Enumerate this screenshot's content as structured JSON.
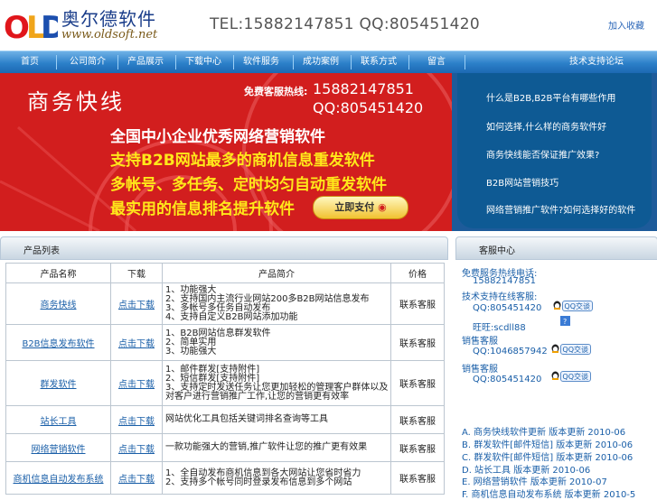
{
  "header": {
    "logo_mark": "OLD",
    "logo_cn": "奥尔德软件",
    "logo_url": "www.oldsoft.net",
    "tel_line": "TEL:15882147851 QQ:805451420",
    "top_link": "加入收藏"
  },
  "nav": {
    "items": [
      "首页",
      "公司简介",
      "产品展示",
      "下载中心",
      "软件服务",
      "成功案例",
      "联系方式",
      "留言",
      "技术支持论坛"
    ]
  },
  "banner": {
    "title": "商务快线",
    "hotline_label": "免费客服热线:",
    "hotline_tel": "15882147851",
    "hotline_qq": "QQ:805451420",
    "slogans": [
      {
        "text": "全国中小企业优秀网络营销软件",
        "color": "#ffffff"
      },
      {
        "text": "支持B2B网站最多的商机信息重发软件",
        "color": "#ffe81a"
      },
      {
        "text": "多帐号、多任务、定时均匀自动重发软件",
        "color": "#ffe81a"
      },
      {
        "text": "最实用的信息排名提升软件",
        "color": "#ffe81a"
      }
    ],
    "pay_button": "立即支付"
  },
  "news": {
    "items": [
      "什么是B2B,B2B平台有哪些作用",
      "如何选择,什么样的商务软件好",
      "商务快线能否保证推广效果?",
      "B2B网站营销技巧",
      "网络营销推广软件?如何选择好的软件"
    ]
  },
  "products": {
    "title": "产品列表",
    "headers": [
      "产品名称",
      "下载",
      "产品简介",
      "价格"
    ],
    "rows": [
      {
        "name": "商务快线",
        "download": "点击下载",
        "desc": [
          "1、功能强大",
          "2、支持国内主流行业网站200多B2B网站信息发布",
          "3、多帐号多任务自动发布",
          "4、支持自定义B2B网站添加功能"
        ],
        "price": "联系客服"
      },
      {
        "name": "B2B信息发布软件",
        "download": "点击下载",
        "desc": [
          "1、B2B网站信息群发软件",
          "2、简单实用",
          "3、功能强大"
        ],
        "price": "联系客服"
      },
      {
        "name": "群发软件",
        "download": "点击下载",
        "desc": [
          "1、邮件群发[支持附件]",
          "2、短信群发[支持附件]",
          "3、支持定时发送任务让您更加轻松的管理客户群体以及对客户进行营销推广工作,让您的营销更有效率"
        ],
        "price": "联系客服"
      },
      {
        "name": "站长工具",
        "download": "点击下载",
        "desc": [
          "网站优化工具包括关键词排名查询等工具"
        ],
        "price": "联系客服"
      },
      {
        "name": "网络营销软件",
        "download": "点击下载",
        "desc": [
          "一款功能强大的营销,推广软件让您的推广更有效果"
        ],
        "price": "联系客服"
      },
      {
        "name": "商机信息自动发布系统",
        "download": "点击下载",
        "desc": [
          "1、全自动发布商机信息到各大网站让您省时省力",
          "2、支持多个帐号同时登录发布信息到多个网站"
        ],
        "price": "联系客服"
      }
    ]
  },
  "service": {
    "title": "客服中心",
    "hotline_label": "免费服务热线电话:",
    "hotline_value": "15882147851",
    "tech_label": "技术支持在线客服:",
    "tech_qq": "QQ:805451420",
    "msn": "旺旺:scdll88",
    "sales1_label": "销售客服",
    "sales1_qq": "QQ:1046857942",
    "sales2_label": "销售客服",
    "sales2_qq": "QQ:805451420",
    "qq_button": "QQ交谈",
    "updates": [
      "A. 商务快线软件更新 版本更新 2010-06",
      "B. 群发软件[邮件短信] 版本更新 2010-06",
      "C. 群发软件[邮件短信] 版本更新 2010-06",
      "D. 站长工具 版本更新 2010-06",
      "E. 网络营销软件 版本更新 2010-07",
      "F. 商机信息自动发布系统 版本更新 2010-5"
    ]
  },
  "colors": {
    "nav": "#2c80c9",
    "banner_red": "#d21e1e",
    "news_blue": "#0e5a94",
    "link": "#1a5fa8"
  }
}
